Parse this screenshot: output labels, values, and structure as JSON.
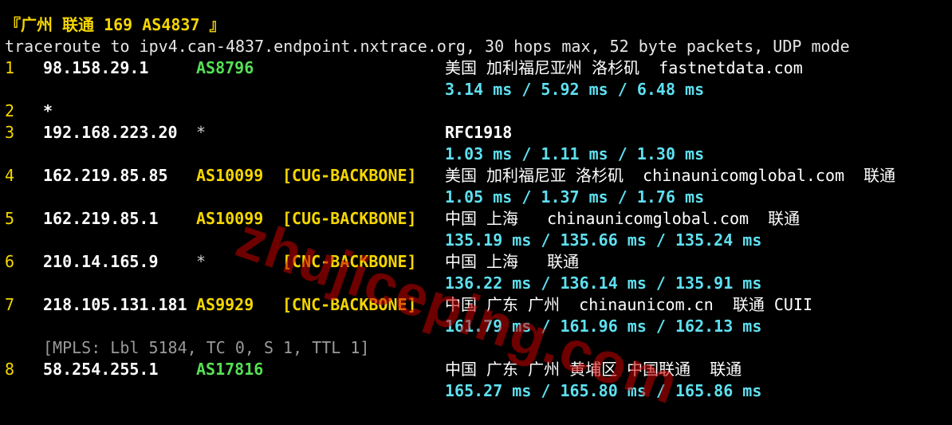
{
  "header": {
    "title": "『广州 联通 169 AS4837 』"
  },
  "command": "traceroute to ipv4.can-4837.endpoint.nxtrace.org, 30 hops max, 52 byte packets, UDP mode",
  "hops": [
    {
      "num": "1",
      "ip": "98.158.29.1",
      "as": "AS8796",
      "as_color": "green",
      "tag": "",
      "geo": "美国 加利福尼亚州 洛杉矶  fastnetdata.com",
      "rtt": "3.14 ms / 5.92 ms / 6.48 ms"
    },
    {
      "num": "2",
      "ip": "*",
      "as": "",
      "as_color": "",
      "tag": "",
      "geo": "",
      "rtt": ""
    },
    {
      "num": "3",
      "ip": "192.168.223.20",
      "as": "*",
      "as_color": "star",
      "tag": "",
      "geo": "RFC1918",
      "rtt": "1.03 ms / 1.11 ms / 1.30 ms"
    },
    {
      "num": "4",
      "ip": "162.219.85.85",
      "as": "AS10099",
      "as_color": "yellow",
      "tag": "[CUG-BACKBONE]",
      "geo": "美国 加利福尼亚 洛杉矶  chinaunicomglobal.com  联通",
      "rtt": "1.05 ms / 1.37 ms / 1.76 ms"
    },
    {
      "num": "5",
      "ip": "162.219.85.1",
      "as": "AS10099",
      "as_color": "yellow",
      "tag": "[CUG-BACKBONE]",
      "geo": "中国 上海   chinaunicomglobal.com  联通",
      "rtt": "135.19 ms / 135.66 ms / 135.24 ms"
    },
    {
      "num": "6",
      "ip": "210.14.165.9",
      "as": "*",
      "as_color": "star",
      "tag": "[CNC-BACKBONE]",
      "geo": "中国 上海   联通",
      "rtt": "136.22 ms / 136.14 ms / 135.91 ms"
    },
    {
      "num": "7",
      "ip": "218.105.131.181",
      "as": "AS9929",
      "as_color": "yellow",
      "tag": "[CNC-BACKBONE]",
      "geo": "中国 广东 广州  chinaunicom.cn  联通 CUII",
      "rtt": "161.79 ms / 161.96 ms / 162.13 ms",
      "mpls": "[MPLS: Lbl 5184, TC 0, S 1, TTL 1]"
    },
    {
      "num": "8",
      "ip": "58.254.255.1",
      "as": "AS17816",
      "as_color": "green",
      "tag": "",
      "geo": "中国 广东 广州 黄埔区 中国联通  联通",
      "rtt": "165.27 ms / 165.80 ms / 165.86 ms"
    }
  ],
  "watermark": "zhujiceping.com"
}
